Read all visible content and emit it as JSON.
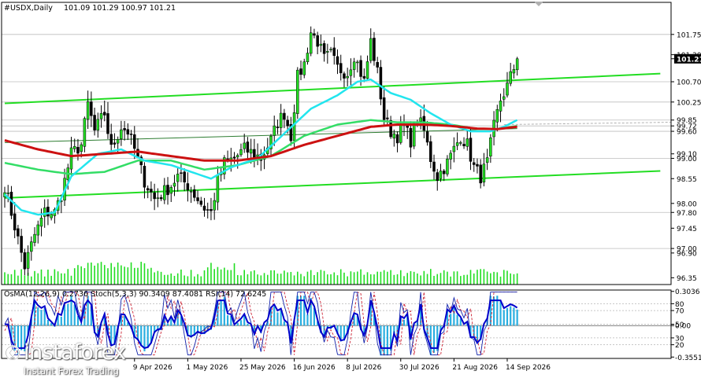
{
  "chart_data": {
    "type": "candlestick",
    "symbol_header": "#USDX,Daily",
    "ohlc_header": "101.09 101.29 100.97 101.21",
    "current_price": 101.21,
    "ylim": [
      96.2,
      102.2
    ],
    "price_labels": [
      {
        "value": 101.75,
        "text": "101.75",
        "line": true
      },
      {
        "value": 101.3,
        "text": "101.30",
        "line": false
      },
      {
        "value": 101.21,
        "text": "101.21",
        "line": false,
        "current": true
      },
      {
        "value": 100.7,
        "text": "100.70",
        "line": true
      },
      {
        "value": 100.25,
        "text": "100.25",
        "line": true
      },
      {
        "value": 99.85,
        "text": "99.85",
        "line": true
      },
      {
        "value": 99.72,
        "text": "99.72",
        "line": true
      },
      {
        "value": 99.6,
        "text": "99.60",
        "line": true
      },
      {
        "value": 99.1,
        "text": "99.10",
        "line": false
      },
      {
        "value": 99.0,
        "text": "99.00",
        "line": true
      },
      {
        "value": 98.55,
        "text": "98.55",
        "line": false
      },
      {
        "value": 98.0,
        "text": "98.00",
        "line": false
      },
      {
        "value": 97.8,
        "text": "97.80",
        "line": true
      },
      {
        "value": 97.45,
        "text": "97.45",
        "line": false
      },
      {
        "value": 97.0,
        "text": "97.00",
        "line": true
      },
      {
        "value": 96.9,
        "text": "96.90",
        "line": false
      },
      {
        "value": 96.35,
        "text": "96.35",
        "line": false
      }
    ],
    "date_labels": [
      "9 Apr 2026",
      "1 May 2026",
      "25 May 2026",
      "16 Jun 2026",
      "8 Jul 2026",
      "30 Jul 2026",
      "21 Aug 2026",
      "14 Sep 2026"
    ],
    "date_label_bars": [
      39,
      55,
      71,
      87,
      103,
      119,
      135,
      151
    ],
    "bar_count": 164,
    "anchors": [
      [
        0,
        98.4
      ],
      [
        3,
        97.5
      ],
      [
        6,
        96.6
      ],
      [
        9,
        97.3
      ],
      [
        12,
        97.8
      ],
      [
        15,
        97.8
      ],
      [
        17,
        98.2
      ],
      [
        20,
        99.1
      ],
      [
        23,
        99.3
      ],
      [
        25,
        100.2
      ],
      [
        27,
        99.6
      ],
      [
        30,
        100.0
      ],
      [
        32,
        99.2
      ],
      [
        35,
        99.7
      ],
      [
        37,
        99.6
      ],
      [
        39,
        99.2
      ],
      [
        42,
        98.5
      ],
      [
        45,
        98.1
      ],
      [
        47,
        98.2
      ],
      [
        50,
        98.4
      ],
      [
        52,
        98.6
      ],
      [
        55,
        98.4
      ],
      [
        57,
        98.2
      ],
      [
        60,
        97.9
      ],
      [
        62,
        97.8
      ],
      [
        64,
        98.5
      ],
      [
        66,
        98.9
      ],
      [
        69,
        99.0
      ],
      [
        72,
        99.2
      ],
      [
        75,
        99.1
      ],
      [
        77,
        99.0
      ],
      [
        80,
        99.4
      ],
      [
        82,
        99.8
      ],
      [
        84,
        100.0
      ],
      [
        86,
        99.5
      ],
      [
        88,
        100.8
      ],
      [
        90,
        101.1
      ],
      [
        92,
        101.8
      ],
      [
        94,
        101.6
      ],
      [
        96,
        101.2
      ],
      [
        98,
        101.3
      ],
      [
        100,
        101.0
      ],
      [
        103,
        100.9
      ],
      [
        105,
        101.3
      ],
      [
        108,
        100.7
      ],
      [
        110,
        101.6
      ],
      [
        112,
        100.9
      ],
      [
        114,
        99.9
      ],
      [
        116,
        99.6
      ],
      [
        118,
        99.5
      ],
      [
        120,
        99.7
      ],
      [
        122,
        99.4
      ],
      [
        124,
        99.9
      ],
      [
        126,
        99.6
      ],
      [
        128,
        99.0
      ],
      [
        130,
        98.6
      ],
      [
        133,
        98.9
      ],
      [
        135,
        99.2
      ],
      [
        137,
        99.5
      ],
      [
        139,
        99.3
      ],
      [
        141,
        98.8
      ],
      [
        143,
        98.6
      ],
      [
        145,
        98.9
      ],
      [
        147,
        99.7
      ],
      [
        149,
        100.3
      ],
      [
        151,
        100.6
      ],
      [
        154,
        101.21
      ]
    ],
    "ma_red": [
      [
        0,
        99.4
      ],
      [
        10,
        99.2
      ],
      [
        20,
        99.05
      ],
      [
        30,
        99.1
      ],
      [
        40,
        99.15
      ],
      [
        50,
        99.05
      ],
      [
        60,
        98.95
      ],
      [
        70,
        98.95
      ],
      [
        80,
        99.05
      ],
      [
        90,
        99.3
      ],
      [
        100,
        99.5
      ],
      [
        110,
        99.7
      ],
      [
        118,
        99.75
      ],
      [
        126,
        99.75
      ],
      [
        134,
        99.72
      ],
      [
        142,
        99.66
      ],
      [
        148,
        99.65
      ],
      [
        154,
        99.7
      ]
    ],
    "ma_green": [
      [
        0,
        98.9
      ],
      [
        10,
        98.75
      ],
      [
        20,
        98.65
      ],
      [
        30,
        98.7
      ],
      [
        40,
        98.95
      ],
      [
        50,
        98.95
      ],
      [
        60,
        98.75
      ],
      [
        70,
        98.85
      ],
      [
        80,
        99.05
      ],
      [
        90,
        99.5
      ],
      [
        100,
        99.75
      ],
      [
        110,
        99.85
      ],
      [
        118,
        99.8
      ],
      [
        126,
        99.8
      ],
      [
        134,
        99.75
      ],
      [
        142,
        99.65
      ],
      [
        148,
        99.65
      ],
      [
        154,
        99.72
      ]
    ],
    "ma_cyan": [
      [
        0,
        98.2
      ],
      [
        5,
        97.85
      ],
      [
        10,
        97.75
      ],
      [
        15,
        97.8
      ],
      [
        20,
        98.6
      ],
      [
        28,
        99.1
      ],
      [
        35,
        99.2
      ],
      [
        42,
        98.95
      ],
      [
        50,
        98.85
      ],
      [
        56,
        98.7
      ],
      [
        62,
        98.55
      ],
      [
        68,
        98.8
      ],
      [
        76,
        99.0
      ],
      [
        84,
        99.55
      ],
      [
        92,
        100.1
      ],
      [
        100,
        100.4
      ],
      [
        106,
        100.7
      ],
      [
        110,
        100.75
      ],
      [
        116,
        100.45
      ],
      [
        122,
        100.3
      ],
      [
        128,
        100.0
      ],
      [
        134,
        99.75
      ],
      [
        140,
        99.6
      ],
      [
        146,
        99.6
      ],
      [
        150,
        99.7
      ],
      [
        154,
        99.85
      ]
    ],
    "trendlines": [
      {
        "name": "upper-channel",
        "color": "#22dd22",
        "points": [
          [
            0,
            100.22
          ],
          [
            197,
            100.88
          ]
        ]
      },
      {
        "name": "lower-channel",
        "color": "#22dd22",
        "points": [
          [
            0,
            98.12
          ],
          [
            197,
            98.72
          ]
        ]
      },
      {
        "name": "thin-support",
        "color": "#2e7d32",
        "points": [
          [
            0,
            99.35
          ],
          [
            154,
            99.66
          ]
        ]
      }
    ],
    "oscillator": {
      "header": "OsMA(12,26,9) 0.2736  Stoch(5,3,3) 90.3409 87.4081  RSI(14) 72.6245",
      "scale_labels": [
        {
          "value": "0.3036",
          "pos": 0.98
        },
        {
          "value": "80",
          "pos": 0.8
        },
        {
          "value": "70",
          "pos": 0.7
        },
        {
          "value": "50",
          "pos": 0.5
        },
        {
          "value": "0.00",
          "pos": 0.48
        },
        {
          "value": "30",
          "pos": 0.3
        },
        {
          "value": "20",
          "pos": 0.2
        },
        {
          "value": "-0.3551",
          "pos": 0.02
        }
      ]
    }
  },
  "branding": {
    "logo": "instaforex",
    "slogan": "Instant Forex Trading"
  },
  "colors": {
    "bull": "#22dd22",
    "bear": "#000000",
    "ma_red": "#cc1111",
    "ma_green": "#33dd66",
    "ma_cyan": "#22e5ee",
    "volume": "#22dd22",
    "osma": "#29aee0",
    "stoch_main": "#1122aa",
    "stoch_signal": "#cc2233",
    "rsi": "#0000cc",
    "current_price_bg": "#000000"
  }
}
